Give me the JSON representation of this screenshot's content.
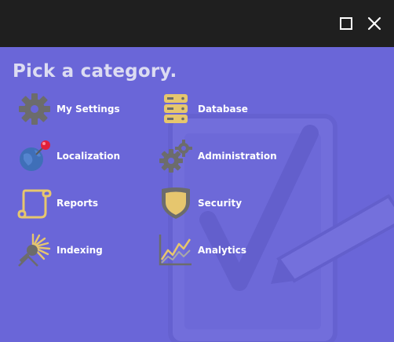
{
  "window": {
    "heading": "Pick a category.",
    "controls": {
      "maximize_icon": "maximize-icon",
      "close_icon": "close-icon"
    }
  },
  "categories": [
    {
      "label": "My Settings",
      "icon": "gear-icon"
    },
    {
      "label": "Database",
      "icon": "database-icon"
    },
    {
      "label": "Localization",
      "icon": "globe-pin-icon"
    },
    {
      "label": "Administration",
      "icon": "gears-icon"
    },
    {
      "label": "Reports",
      "icon": "scroll-icon"
    },
    {
      "label": "Security",
      "icon": "shield-icon"
    },
    {
      "label": "Indexing",
      "icon": "telescope-icon"
    },
    {
      "label": "Analytics",
      "icon": "chart-icon"
    }
  ],
  "colors": {
    "titlebar": "#1f1f1f",
    "background": "#6a66d8",
    "heading": "#dcdcf2",
    "label": "#ffffff",
    "icon_gold": "#e6c66e",
    "icon_gray": "#6c6c6c"
  }
}
